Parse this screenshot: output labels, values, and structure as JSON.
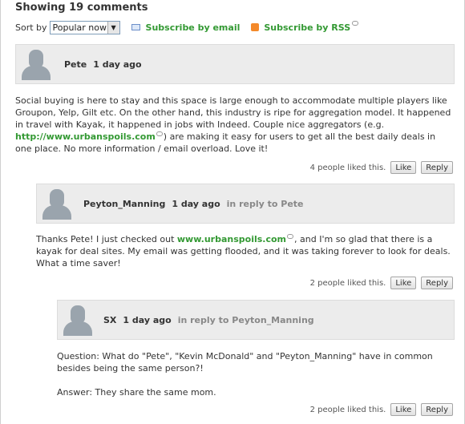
{
  "header": {
    "title": "Showing 19 comments"
  },
  "sortbar": {
    "sort_label": "Sort by",
    "sort_value": "Popular now",
    "subscribe_email": "Subscribe by email",
    "subscribe_rss": "Subscribe by RSS"
  },
  "comments": [
    {
      "author": "Pete",
      "time": "1 day ago",
      "reply_to": "",
      "text_a": "Social buying is here to stay and this space is large enough to accommodate multiple players like Groupon, Yelp, Gilt etc. On the other hand, this industry is ripe for aggregation model. It happened in travel with Kayak, it happened in jobs with Indeed. Couple nice aggregators (e.g. ",
      "link": "http://www.urbanspoils.com",
      "text_b": ") are making it easy for users to get all the best daily deals in one place. No more information / email overload. Love it!",
      "likes": "4 people liked this.",
      "like_label": "Like",
      "reply_label": "Reply"
    },
    {
      "author": "Peyton_Manning",
      "time": "1 day ago",
      "reply_to": "in reply to Pete",
      "text_a": "Thanks Pete! I just checked out ",
      "link": "www.urbanspoils.com",
      "text_b": ", and I'm so glad that there is a kayak for deal sites. My email was getting flooded, and it was taking forever to look for deals. What a time saver!",
      "likes": "2 people liked this.",
      "like_label": "Like",
      "reply_label": "Reply"
    },
    {
      "author": "SX",
      "time": "1 day ago",
      "reply_to": "in reply to Peyton_Manning",
      "text_a": "Question: What do \"Pete\", \"Kevin McDonald\" and \"Peyton_Manning\" have in common besides being the same person?!",
      "text_b": "Answer: They share the same mom.",
      "likes": "2 people liked this.",
      "like_label": "Like",
      "reply_label": "Reply"
    }
  ]
}
